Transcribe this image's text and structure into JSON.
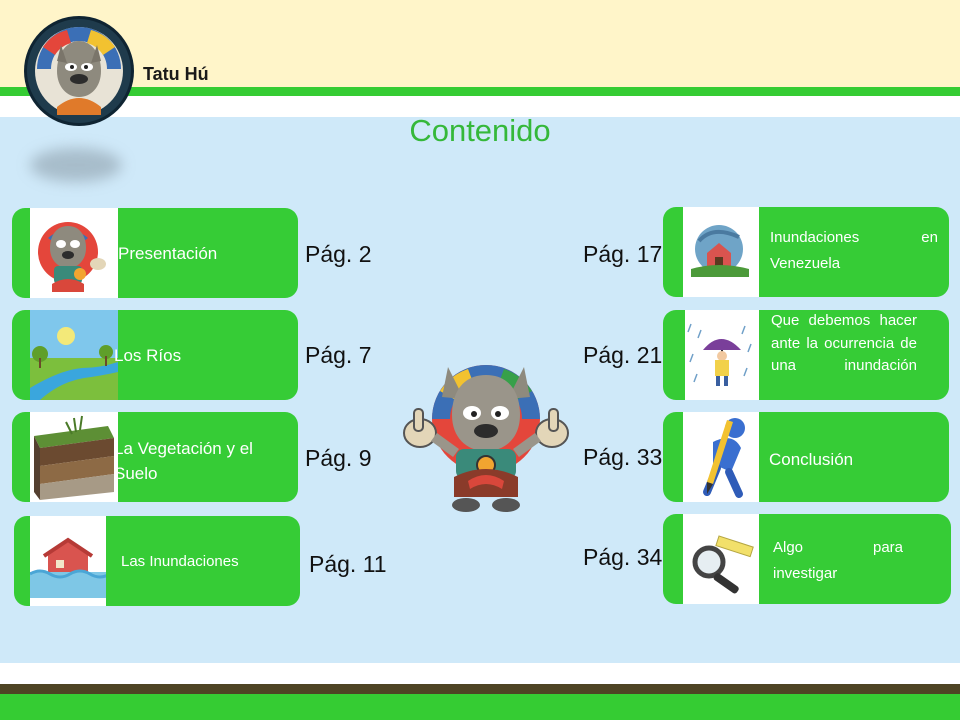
{
  "header": {
    "brand": "Tatu Hú"
  },
  "title": "Contenido",
  "left_items": [
    {
      "label": "Presentación",
      "page": "Pág. 2",
      "icon": "armadillo-mascot-icon"
    },
    {
      "label": "Los Ríos",
      "page": "Pág. 7",
      "icon": "river-landscape-icon"
    },
    {
      "label": "La Vegetación y el Suelo",
      "page": "Pág. 9",
      "icon": "soil-layers-icon"
    },
    {
      "label": "Las Inundaciones",
      "page": "Pág. 11",
      "icon": "flooded-house-icon"
    }
  ],
  "right_items": [
    {
      "label": "Inundaciones en Venezuela",
      "page": "Pág. 17",
      "icon": "storm-house-icon"
    },
    {
      "label": "Que debemos hacer ante la ocurrencia de una inundación",
      "page": "Pág. 21",
      "icon": "person-umbrella-rain-icon"
    },
    {
      "label": "Conclusión",
      "page": "Pág. 33",
      "icon": "figure-with-pencil-icon"
    },
    {
      "label": "Algo para investigar",
      "page": "Pág. 34",
      "icon": "magnifying-glass-icon"
    }
  ],
  "colors": {
    "card": "#36cc36",
    "title": "#35b83a",
    "panel": "#cfe9f9",
    "top_band": "#fff5c9"
  }
}
